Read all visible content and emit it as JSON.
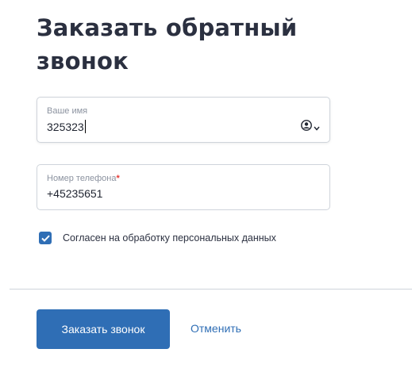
{
  "form": {
    "title": "Заказать обратный звонок",
    "name_field": {
      "label": "Ваше имя",
      "value": "325323",
      "autofill_icon": "contact-autofill-icon",
      "dropdown_icon": "chevron-down-icon"
    },
    "phone_field": {
      "label": "Номер телефона",
      "required_mark": "*",
      "value": "+45235651"
    },
    "consent": {
      "checked": true,
      "label": "Согласен на обработку персональных данных"
    },
    "actions": {
      "submit_label": "Заказать звонок",
      "cancel_label": "Отменить"
    }
  },
  "colors": {
    "accent": "#2f6eb5",
    "title_text": "#2b3040",
    "border": "#cfd4db",
    "required": "#e53935"
  }
}
